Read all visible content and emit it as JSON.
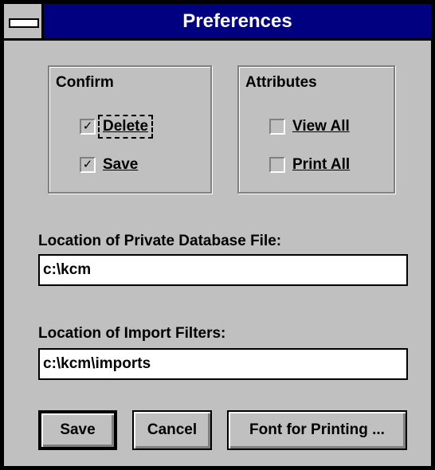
{
  "window": {
    "title": "Preferences"
  },
  "confirm_group": {
    "title": "Confirm",
    "delete_label": "Delete",
    "delete_checked": true,
    "save_label": "Save",
    "save_checked": true
  },
  "attributes_group": {
    "title": "Attributes",
    "view_all_label": "View All",
    "view_all_checked": false,
    "print_all_label": "Print All",
    "print_all_checked": false
  },
  "database_file": {
    "label": "Location of Private Database File:",
    "value": "c:\\kcm"
  },
  "import_filters": {
    "label": "Location of Import Filters:",
    "value": "c:\\kcm\\imports"
  },
  "buttons": {
    "save": "Save",
    "cancel": "Cancel",
    "font": "Font for Printing ..."
  },
  "glyphs": {
    "check": "✓"
  }
}
